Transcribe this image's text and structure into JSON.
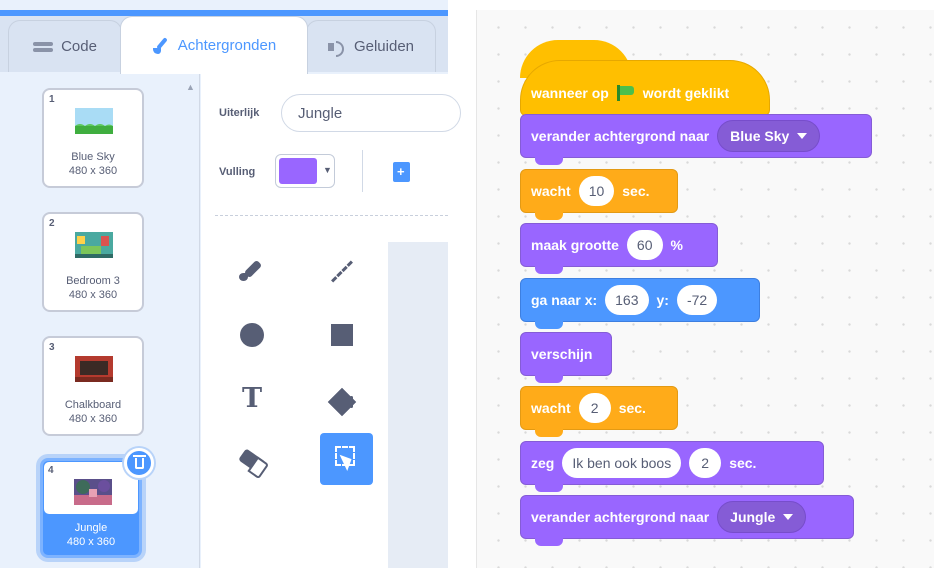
{
  "tabs": [
    {
      "label": "Code",
      "icon": "code-icon",
      "active": false
    },
    {
      "label": "Achtergronden",
      "icon": "brush-icon",
      "active": true
    },
    {
      "label": "Geluiden",
      "icon": "speaker-icon",
      "active": false
    }
  ],
  "backdrops": [
    {
      "number": "1",
      "name": "Blue Sky",
      "size": "480 x 360"
    },
    {
      "number": "2",
      "name": "Bedroom 3",
      "size": "480 x 360"
    },
    {
      "number": "3",
      "name": "Chalkboard",
      "size": "480 x 360"
    },
    {
      "number": "4",
      "name": "Jungle",
      "size": "480 x 360",
      "selected": true
    }
  ],
  "paint_editor": {
    "costume_label": "Uiterlijk",
    "costume_name": "Jungle",
    "fill_label": "Vulling",
    "fill_color": "#9966ff",
    "tools": [
      "brush",
      "line",
      "circle",
      "rectangle",
      "text",
      "fill",
      "eraser",
      "select"
    ],
    "active_tool": "select"
  },
  "script": {
    "hat": {
      "pre": "wanneer op",
      "post": "wordt geklikt"
    },
    "b1": {
      "text": "verander achtergrond naar",
      "dropdown": "Blue Sky"
    },
    "b2": {
      "pre": "wacht",
      "value": "10",
      "post": "sec."
    },
    "b3": {
      "pre": "maak grootte",
      "value": "60",
      "post": "%"
    },
    "b4": {
      "pre": "ga naar x:",
      "x": "163",
      "ylabel": "y:",
      "y": "-72"
    },
    "b5": {
      "text": "verschijn"
    },
    "b6": {
      "pre": "wacht",
      "value": "2",
      "post": "sec."
    },
    "b7": {
      "pre": "zeg",
      "message": "Ik ben ook boos",
      "value": "2",
      "post": "sec."
    },
    "b8": {
      "text": "verander achtergrond naar",
      "dropdown": "Jungle"
    }
  },
  "colors": {
    "events": "#ffbf00",
    "looks": "#9966ff",
    "control": "#ffab19",
    "motion": "#4c97ff",
    "accent": "#4c97ff"
  }
}
